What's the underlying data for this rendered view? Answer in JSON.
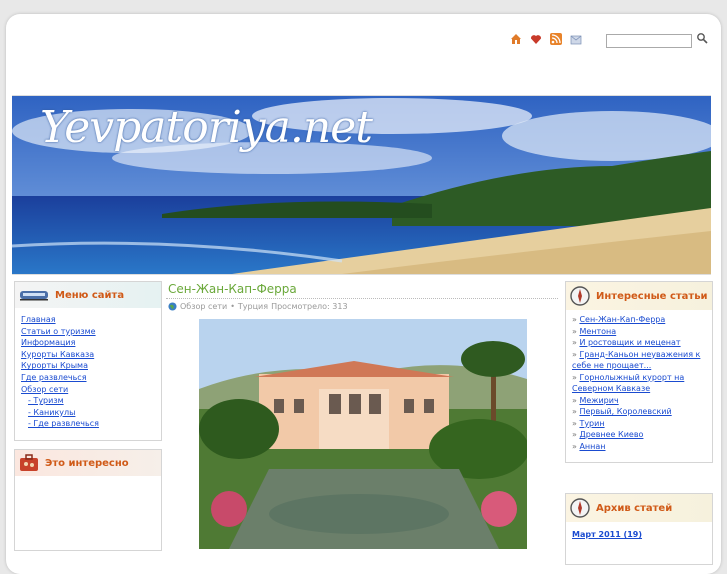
{
  "site": {
    "banner_title": "Yevpatoriya.net"
  },
  "header": {
    "icons": [
      "home-icon",
      "favorite-heart-icon",
      "rss-icon",
      "mail-icon"
    ],
    "search": {
      "value": "",
      "placeholder": ""
    }
  },
  "left_menu": {
    "title": "Меню сайта",
    "items": [
      {
        "label": "Главная"
      },
      {
        "label": "Статьи о туризме"
      },
      {
        "label": "Информация"
      },
      {
        "label": "Курорты Кавказа"
      },
      {
        "label": "Курорты Крыма"
      },
      {
        "label": "Где развлечься"
      },
      {
        "label": "Обзор сети"
      }
    ],
    "subitems": [
      {
        "label": "- Туризм"
      },
      {
        "label": "- Каникулы"
      },
      {
        "label": "- Где развлечься"
      }
    ]
  },
  "left_interesting": {
    "title": "Это интересно"
  },
  "post": {
    "title": "Сен-Жан-Кап-Ферра",
    "category": "Обзор сети",
    "tags": "Турция",
    "views_label": "Просмотрело: 313"
  },
  "right_articles": {
    "title": "Интересные статьи",
    "items": [
      {
        "label": "Сен-Жан-Кап-Ферра"
      },
      {
        "label": "Ментона"
      },
      {
        "label": "И ростовщик и меценат"
      },
      {
        "label": "Гранд-Каньон неуважения к себе не прощает..."
      },
      {
        "label": "Горнолыжный курорт на Северном Кавказе"
      },
      {
        "label": "Межирич"
      },
      {
        "label": "Первый, Королевский"
      },
      {
        "label": "Турин"
      },
      {
        "label": "Древнее Киево"
      },
      {
        "label": "Аннан"
      }
    ]
  },
  "archive": {
    "title": "Архив статей",
    "first_item": "Март 2011 (19)"
  },
  "colors": {
    "accent": "#d05a18",
    "link": "#1a4bd0",
    "title_green": "#6aa83a"
  }
}
